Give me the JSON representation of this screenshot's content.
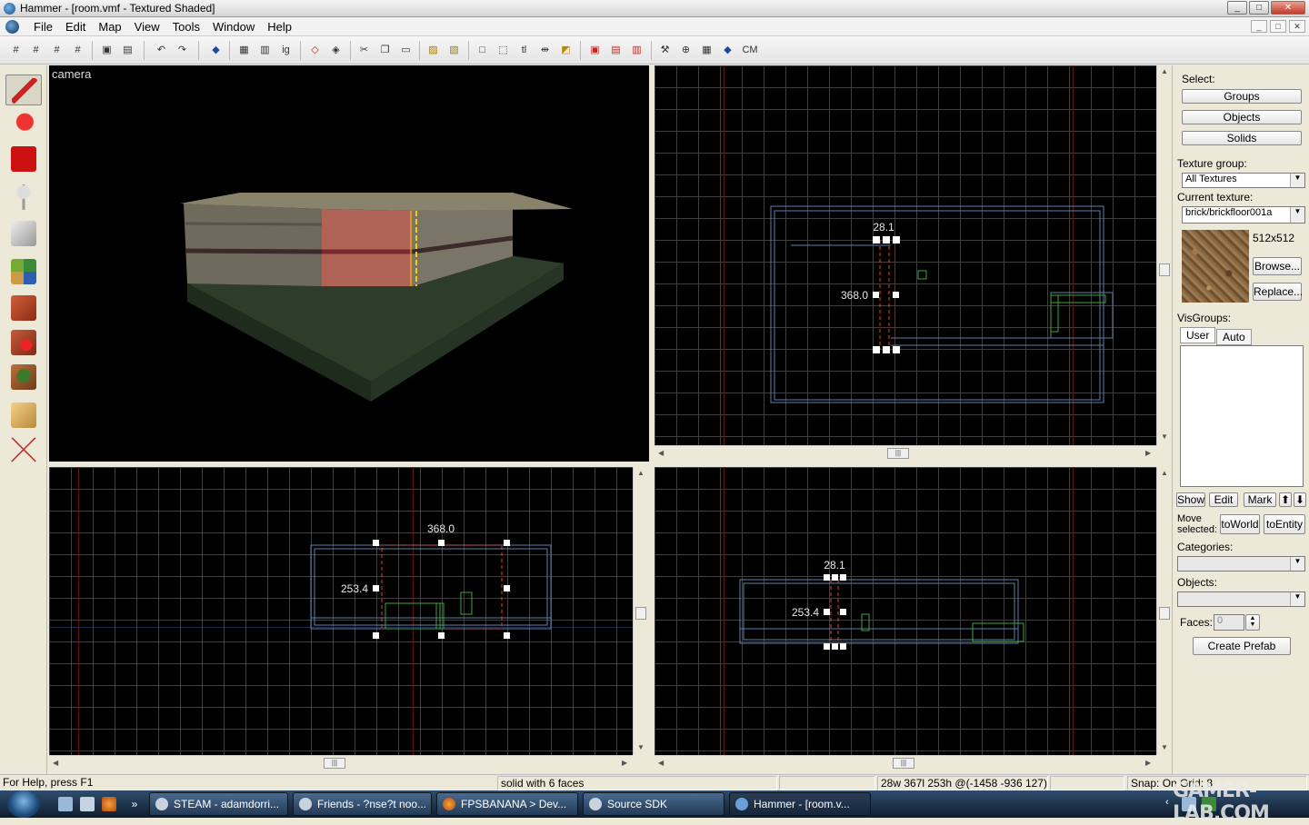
{
  "window": {
    "title": "Hammer - [room.vmf - Textured Shaded]",
    "buttons": [
      "_",
      "□",
      "✕"
    ]
  },
  "menu": {
    "items": [
      "File",
      "Edit",
      "Map",
      "View",
      "Tools",
      "Window",
      "Help"
    ],
    "mdi_buttons": [
      "_",
      "□",
      "✕"
    ]
  },
  "toolbar": {
    "items": [
      "grid-toggle",
      "grid-smaller",
      "grid-larger",
      "grid-3d",
      "snap",
      "group",
      "ungroup",
      "undo",
      "redo",
      "carve",
      "hollow",
      "ig",
      "hide",
      "unhide",
      "cut",
      "copy",
      "paste",
      "texture-lock",
      "texture-scale-lock",
      "bounding",
      "select-handles",
      "tl",
      "flip",
      "rotate",
      "cordon",
      "cordon-off",
      "cordon-edit",
      "compile",
      "entity-report",
      "wireframe",
      "map-check",
      "CM"
    ],
    "ig_label": "ig",
    "tl_label": "tl",
    "cm_label": "CM"
  },
  "tools": [
    "selection-tool",
    "magnify-tool",
    "camera-tool",
    "entity-tool",
    "block-tool",
    "texture-application-tool",
    "apply-current-texture-tool",
    "decal-tool",
    "overlay-tool",
    "clipping-tool",
    "vertex-tool"
  ],
  "viewports": {
    "camera": {
      "label": "camera"
    },
    "top": {
      "labels": {
        "width": "28.1",
        "depth": "368.0"
      }
    },
    "front": {
      "labels": {
        "width": "368.0",
        "height": "253.4"
      }
    },
    "side": {
      "labels": {
        "width": "28.1",
        "height": "253.4"
      }
    }
  },
  "right_panel": {
    "select_label": "Select:",
    "select_buttons": [
      "Groups",
      "Objects",
      "Solids"
    ],
    "texture_group_label": "Texture group:",
    "texture_group_value": "All Textures",
    "current_texture_label": "Current texture:",
    "current_texture_value": "brick/brickfloor001a",
    "texture_size": "512x512",
    "browse_label": "Browse...",
    "replace_label": "Replace...",
    "visgroups_label": "VisGroups:",
    "vis_tabs": [
      "User",
      "Auto"
    ],
    "vis_buttons": [
      "Show",
      "Edit",
      "Mark"
    ],
    "move_selected_label": "Move selected:",
    "to_world_label": "toWorld",
    "to_entity_label": "toEntity",
    "categories_label": "Categories:",
    "objects_label": "Objects:",
    "faces_label": "Faces:",
    "faces_value": "0",
    "create_prefab_label": "Create Prefab"
  },
  "status": {
    "help": "For Help, press F1",
    "selection": "solid with 6 faces",
    "size": "28w 367l 253h @(-1458 -936 127)",
    "snap": "Snap: On Grid: 8"
  },
  "taskbar": {
    "tasks": [
      {
        "label": "STEAM - adamdorri..."
      },
      {
        "label": "Friends - ?nse?t noo..."
      },
      {
        "label": "FPSBANANA > Dev..."
      },
      {
        "label": "Source SDK"
      },
      {
        "label": "Hammer - [room.v..."
      }
    ]
  },
  "watermark": "GAMER-LAB.COM"
}
